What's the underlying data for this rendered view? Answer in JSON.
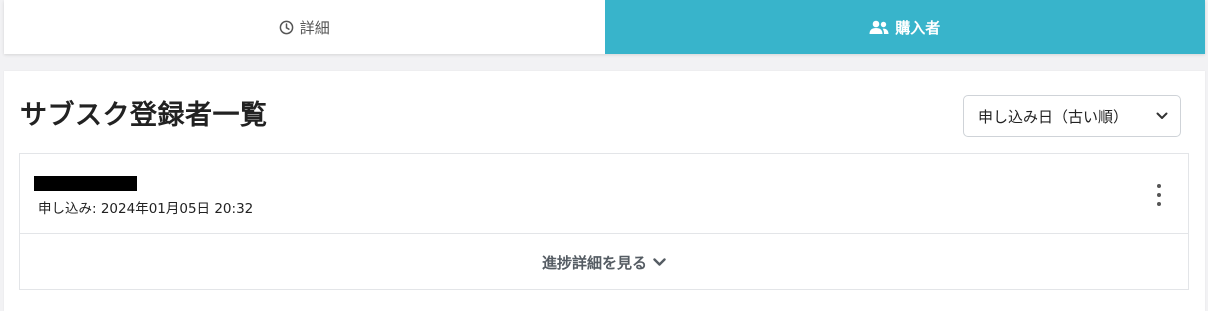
{
  "tabs": [
    {
      "label": "詳細",
      "icon": "clock-icon",
      "active": false
    },
    {
      "label": "購入者",
      "icon": "users-icon",
      "active": true
    }
  ],
  "colors": {
    "accent": "#38b4cb",
    "background": "#f2f2f4"
  },
  "main": {
    "title": "サブスク登録者一覧",
    "sort": {
      "selected": "申し込み日（古い順）"
    },
    "subscribers": [
      {
        "name_redacted": true,
        "applied_text": "申し込み: 2024年01月05日 20:32",
        "toggle_label": "進捗詳細を見る"
      }
    ]
  }
}
